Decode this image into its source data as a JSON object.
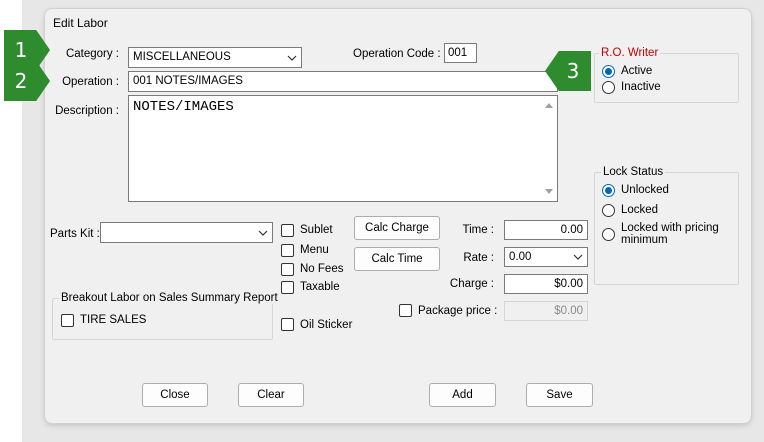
{
  "window": {
    "title": "Edit Labor"
  },
  "form": {
    "category_label": "Category :",
    "category_value": "MISCELLANEOUS",
    "operation_code_label": "Operation Code :",
    "operation_code_value": "001",
    "operation_label": "Operation :",
    "operation_value": "001 NOTES/IMAGES",
    "description_label": "Description :",
    "description_value": "NOTES/IMAGES",
    "parts_kit_label": "Parts Kit :",
    "parts_kit_value": ""
  },
  "checkboxes": {
    "sublet": "Sublet",
    "menu": "Menu",
    "no_fees": "No Fees",
    "taxable": "Taxable",
    "oil_sticker": "Oil Sticker",
    "package_price": "Package price :"
  },
  "calc": {
    "calc_charge": "Calc Charge",
    "calc_time": "Calc Time",
    "time_label": "Time :",
    "time_value": "0.00",
    "rate_label": "Rate :",
    "rate_value": "0.00",
    "charge_label": "Charge :",
    "charge_value": "$0.00",
    "package_value": "$0.00"
  },
  "breakout": {
    "title": "Breakout Labor on Sales Summary Report",
    "tire_sales": "TIRE SALES"
  },
  "ro_writer": {
    "title": "R.O. Writer",
    "active": "Active",
    "inactive": "Inactive",
    "selected": "Active",
    "title_color": "#c00000"
  },
  "lock_status": {
    "title": "Lock Status",
    "unlocked": "Unlocked",
    "locked": "Locked",
    "locked_min_line1": "Locked with pricing",
    "locked_min_line2": "minimum",
    "selected": "Unlocked"
  },
  "buttons": {
    "close": "Close",
    "clear": "Clear",
    "add": "Add",
    "save": "Save"
  },
  "callouts": {
    "one": "1",
    "two": "2",
    "three": "3",
    "color": "#2e8b2e"
  },
  "icons": [
    "chevron-down-icon",
    "scroll-up-icon",
    "scroll-down-icon",
    "radio-icon",
    "checkbox-icon"
  ]
}
